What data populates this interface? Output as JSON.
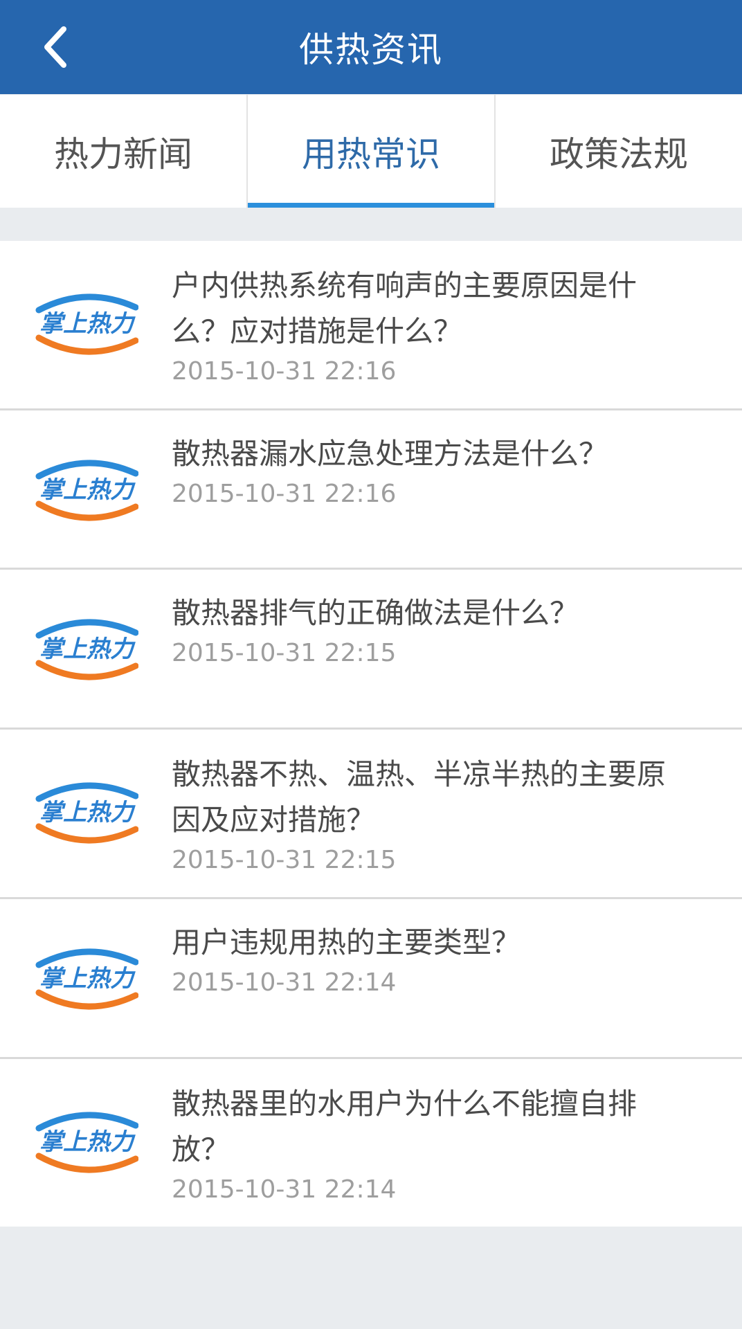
{
  "header": {
    "title": "供热资讯"
  },
  "tabs": [
    {
      "label": "热力新闻"
    },
    {
      "label": "用热常识"
    },
    {
      "label": "政策法规"
    }
  ],
  "logo": {
    "text": "掌上热力"
  },
  "colors": {
    "appbar": "#2666ae",
    "tab_active": "#2e6aa8",
    "indicator": "#2b8fdc",
    "logo_blue": "#2a8ad8",
    "logo_orange": "#ef7a22"
  },
  "articles": [
    {
      "title": "户内供热系统有响声的主要原因是什么？应对措施是什么？",
      "time": "2015-10-31 22:16"
    },
    {
      "title": "散热器漏水应急处理方法是什么？",
      "time": "2015-10-31 22:16"
    },
    {
      "title": "散热器排气的正确做法是什么？",
      "time": "2015-10-31 22:15"
    },
    {
      "title": "散热器不热、温热、半凉半热的主要原因及应对措施？",
      "time": "2015-10-31 22:15"
    },
    {
      "title": "用户违规用热的主要类型？",
      "time": "2015-10-31 22:14"
    },
    {
      "title": "散热器里的水用户为什么不能擅自排放？",
      "time": "2015-10-31 22:14"
    }
  ]
}
